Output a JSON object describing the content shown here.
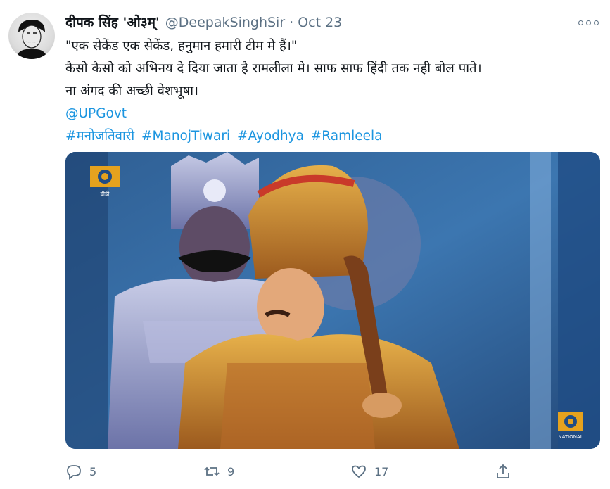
{
  "author": {
    "display_name": "दीपक सिंह 'ओ३म्'",
    "handle": "@DeepakSinghSir",
    "date": "Oct 23"
  },
  "tweet": {
    "lines": [
      "\"एक सेकेंड एक सेकेंड, हनुमान हमारी टीम मे हैं।\"",
      "कैसो कैसो को अभिनय दे दिया जाता है रामलीला मे। साफ साफ हिंदी तक नही बोल पाते।",
      "ना अंगद की अच्छी वेशभूषा।"
    ],
    "mention": "@UPGovt",
    "hashtags": [
      "#मनोजतिवारी",
      "#ManojTiwari",
      "#Ayodhya",
      "#Ramleela"
    ]
  },
  "media": {
    "logo_text_top": "डीडी",
    "logo_text_bottom": "NATIONAL"
  },
  "actions": {
    "reply_count": "5",
    "retweet_count": "9",
    "like_count": "17"
  },
  "icons": {
    "more": "more-icon",
    "reply": "reply-icon",
    "retweet": "retweet-icon",
    "like": "heart-icon",
    "share": "share-icon"
  }
}
